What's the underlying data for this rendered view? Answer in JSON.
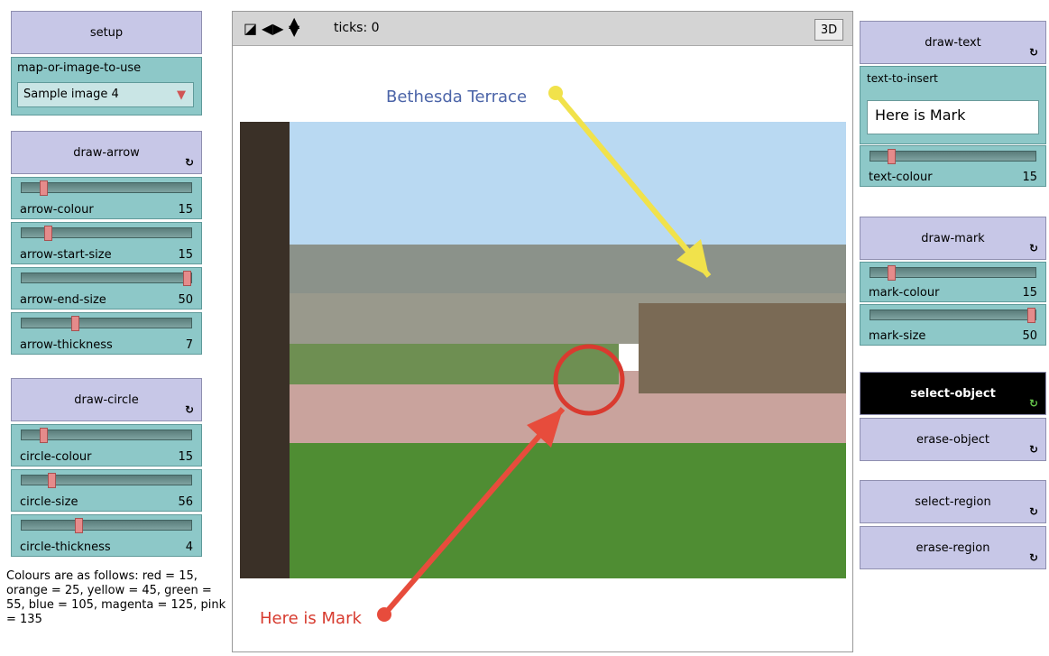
{
  "left_panel": {
    "setup_label": "setup",
    "chooser": {
      "label": "map-or-image-to-use",
      "value": "Sample image 4"
    },
    "draw_arrow": {
      "label": "draw-arrow",
      "icon": "forever-icon"
    },
    "arrow_sliders": [
      {
        "label": "arrow-colour",
        "value": "15",
        "level": 0.11
      },
      {
        "label": "arrow-start-size",
        "value": "15",
        "level": 0.14
      },
      {
        "label": "arrow-end-size",
        "value": "50",
        "level": 1.0
      },
      {
        "label": "arrow-thickness",
        "value": "7",
        "level": 0.31
      }
    ],
    "draw_circle": {
      "label": "draw-circle",
      "icon": "forever-icon"
    },
    "circle_sliders": [
      {
        "label": "circle-colour",
        "value": "15",
        "level": 0.11
      },
      {
        "label": "circle-size",
        "value": "56",
        "level": 0.16
      },
      {
        "label": "circle-thickness",
        "value": "4",
        "level": 0.33
      }
    ],
    "note": "Colours are as follows: red = 15, orange = 25, yellow = 45, green = 55, blue = 105, magenta = 125, pink = 135"
  },
  "view": {
    "ticks_label": "ticks: 0",
    "three_d_label": "3D",
    "annotation_top": "Bethesda Terrace",
    "annotation_bottom": "Here is Mark",
    "colors": {
      "arrow_top": "#f1e24b",
      "arrow_bottom": "#e74c3c",
      "circle": "#d93a2f",
      "text_top": "#4b64a8",
      "text_bottom": "#d73b2f"
    }
  },
  "right_panel": {
    "draw_text": {
      "label": "draw-text",
      "icon": "forever-icon"
    },
    "text_input": {
      "label": "text-to-insert",
      "value": "Here is Mark"
    },
    "text_colour": {
      "label": "text-colour",
      "value": "15",
      "level": 0.11
    },
    "draw_mark": {
      "label": "draw-mark",
      "icon": "forever-icon"
    },
    "mark_colour": {
      "label": "mark-colour",
      "value": "15",
      "level": 0.11
    },
    "mark_size": {
      "label": "mark-size",
      "value": "50",
      "level": 1.0
    },
    "select_object": {
      "label": "select-object",
      "icon": "forever-icon"
    },
    "erase_object": {
      "label": "erase-object",
      "icon": "forever-icon"
    },
    "select_region": {
      "label": "select-region",
      "icon": "forever-icon"
    },
    "erase_region": {
      "label": "erase-region",
      "icon": "forever-icon"
    }
  }
}
